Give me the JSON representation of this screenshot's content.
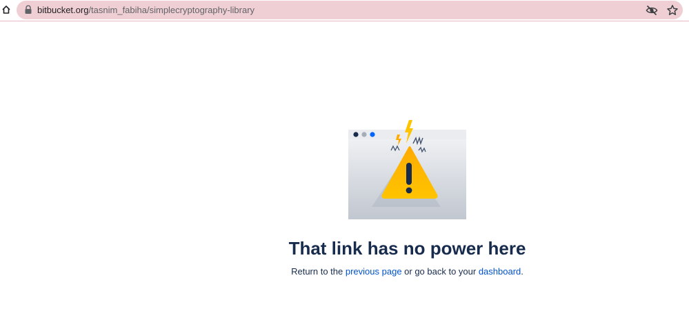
{
  "browser": {
    "url_host": "bitbucket.org",
    "url_path": "/tasnim_fabiha/simplecryptography-library",
    "icons": [
      "home-icon",
      "lock-icon",
      "eye-off-icon",
      "star-icon"
    ]
  },
  "error": {
    "title": "That link has no power here",
    "message_prefix": "Return to the ",
    "link_previous": "previous page",
    "message_middle": " or go back to your ",
    "link_dashboard": "dashboard",
    "message_suffix": "."
  },
  "colors": {
    "heading": "#172b4d",
    "link": "#0052cc",
    "omnibox": "#f0cfd4",
    "warning_yellow": "#ffc400",
    "window_dot_dark": "#172b4d",
    "window_dot_grey": "#a5adba",
    "window_dot_blue": "#0065ff"
  }
}
